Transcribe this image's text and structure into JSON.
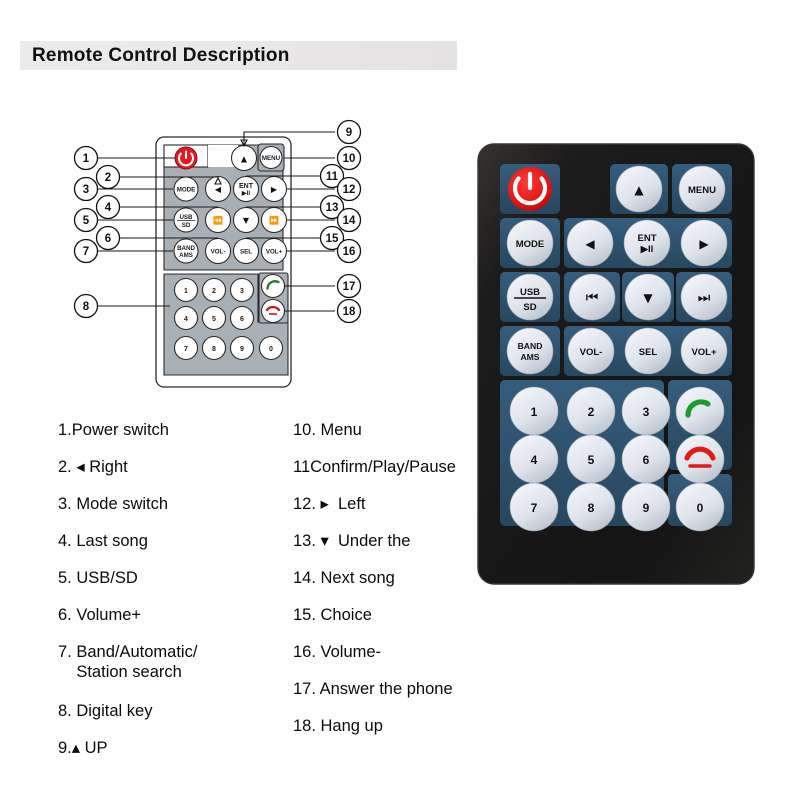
{
  "header": {
    "title": "Remote Control Description",
    "bar_color": "#eceaea"
  },
  "colors": {
    "power_red": "#e8171f",
    "call_green": "#1d9b2e",
    "hangup_red": "#e01b18",
    "remote_body": "#1b1b1d",
    "remote_panel": "#2e5574",
    "remote_key": "#d9dee6",
    "diagram_panel": "#a9b0b5",
    "diagram_key": "#ffffff",
    "callout_18_ring": "#b6264a",
    "text": "#0b0b0b"
  },
  "diagram": {
    "name": "remote-line-drawing",
    "rows": [
      {
        "keys": [
          "power",
          "up",
          "menu"
        ]
      },
      {
        "keys": [
          "mode",
          "left",
          "ent-play-pause",
          "right"
        ]
      },
      {
        "keys": [
          "usb-sd",
          "prev-track",
          "down",
          "next-track"
        ]
      },
      {
        "keys": [
          "band-ams",
          "vol-minus",
          "sel",
          "vol-plus"
        ]
      },
      {
        "keys": [
          "1",
          "2",
          "3",
          "call-answer"
        ]
      },
      {
        "keys": [
          "4",
          "5",
          "6",
          "call-hangup"
        ]
      },
      {
        "keys": [
          "7",
          "8",
          "9",
          "0"
        ]
      }
    ],
    "key_labels": {
      "power": "",
      "up": "▲",
      "menu": "MENU",
      "mode": "MODE",
      "left": "◄",
      "ent_line1": "ENT",
      "ent_line2": "►II",
      "right": "►",
      "usb_line1": "USB",
      "usb_line2": "SD",
      "prev": "⏮",
      "down": "▼",
      "next": "⏭",
      "band_line1": "BAND",
      "band_line2": "AMS",
      "vol_minus": "VOL-",
      "sel": "SEL",
      "vol_plus": "VOL+",
      "digits": [
        "1",
        "2",
        "3",
        "4",
        "5",
        "6",
        "7",
        "8",
        "9",
        "0"
      ]
    },
    "callouts": [
      {
        "n": "1",
        "target": "power"
      },
      {
        "n": "2",
        "target": "left"
      },
      {
        "n": "3",
        "target": "mode"
      },
      {
        "n": "4",
        "target": "prev-track"
      },
      {
        "n": "5",
        "target": "usb-sd"
      },
      {
        "n": "6",
        "target": "vol-minus"
      },
      {
        "n": "7",
        "target": "band-ams"
      },
      {
        "n": "8",
        "target": "keypad"
      },
      {
        "n": "9",
        "target": "up"
      },
      {
        "n": "10",
        "target": "menu"
      },
      {
        "n": "11",
        "target": "ent-play-pause"
      },
      {
        "n": "12",
        "target": "right"
      },
      {
        "n": "13",
        "target": "down"
      },
      {
        "n": "14",
        "target": "next-track"
      },
      {
        "n": "15",
        "target": "sel"
      },
      {
        "n": "16",
        "target": "vol-plus"
      },
      {
        "n": "17",
        "target": "call-answer"
      },
      {
        "n": "18",
        "target": "call-hangup"
      }
    ]
  },
  "legend": {
    "left": [
      "1.Power switch",
      "2. ◂ Right",
      "3. Mode switch",
      "4. Last song",
      "5. USB/SD",
      "6. Volume+",
      "7. Band/Automatic/\n    Station search",
      "8. Digital key",
      "9.▴ UP"
    ],
    "right": [
      "10. Menu",
      "11Confirm/Play/Pause",
      "12. ▸  Left",
      "13. ▾  Under the",
      "14. Next song",
      "15. Choice",
      "16. Volume-",
      "17. Answer the phone",
      "18. Hang up"
    ]
  },
  "photo": {
    "name": "remote-photograph",
    "rows": [
      {
        "keys": [
          "power",
          "up",
          "menu"
        ]
      },
      {
        "keys": [
          "mode",
          "left",
          "ent",
          "right"
        ]
      },
      {
        "keys": [
          "usb-sd",
          "prev",
          "down",
          "next"
        ]
      },
      {
        "keys": [
          "band-ams",
          "vol-minus",
          "sel",
          "vol-plus"
        ]
      },
      {
        "keys": [
          "1",
          "2",
          "3",
          "call-answer"
        ]
      },
      {
        "keys": [
          "4",
          "5",
          "6",
          "call-hangup"
        ]
      },
      {
        "keys": [
          "7",
          "8",
          "9",
          "0"
        ]
      }
    ],
    "labels": {
      "menu": "MENU",
      "mode": "MODE",
      "ent_1": "ENT",
      "ent_2": "▶II",
      "usb_1": "USB",
      "usb_2": "SD",
      "band_1": "BAND",
      "band_2": "AMS",
      "vol_minus": "VOL-",
      "sel": "SEL",
      "vol_plus": "VOL+",
      "up": "▲",
      "down": "▼",
      "left": "◀",
      "right": "▶",
      "prev": "⏮",
      "next": "⏭",
      "digits": [
        "1",
        "2",
        "3",
        "4",
        "5",
        "6",
        "7",
        "8",
        "9",
        "0"
      ]
    }
  }
}
